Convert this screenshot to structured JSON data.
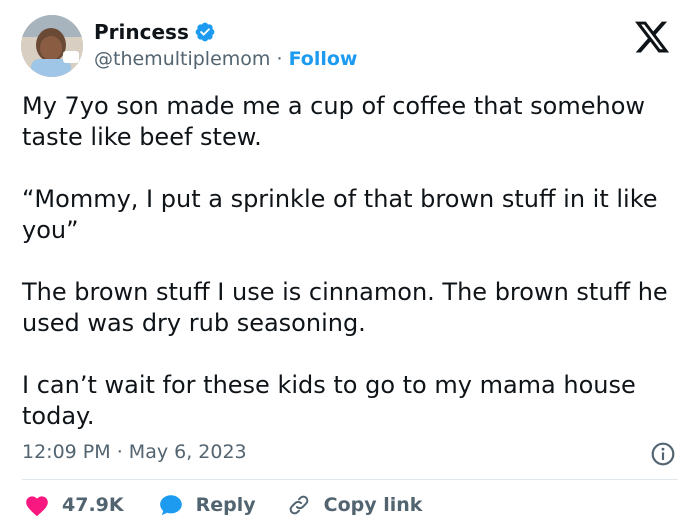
{
  "author": {
    "name": "Princess",
    "handle": "@themultiplemom",
    "separator": "·",
    "follow_label": "Follow"
  },
  "icons": {
    "verified": "verified-badge-icon",
    "logo": "x-logo-icon",
    "info": "info-icon",
    "like": "heart-icon",
    "reply": "speech-bubble-icon",
    "copy": "link-icon"
  },
  "colors": {
    "accent": "#1d9bf0",
    "like": "#f91880",
    "text": "#0f1419",
    "muted": "#536471"
  },
  "tweet": {
    "paragraphs": [
      "My 7yo son made me a cup of coffee that somehow taste like beef stew.",
      "“Mommy, I put a sprinkle of that brown stuff in it like you”",
      "The brown stuff I use is cinnamon. The brown stuff he used was dry rub seasoning.",
      "I can’t wait for these kids to go to my mama house today."
    ],
    "time": "12:09 PM",
    "date_separator": "·",
    "date": "May 6, 2023"
  },
  "actions": {
    "likes": "47.9K",
    "reply_label": "Reply",
    "copy_label": "Copy link"
  }
}
